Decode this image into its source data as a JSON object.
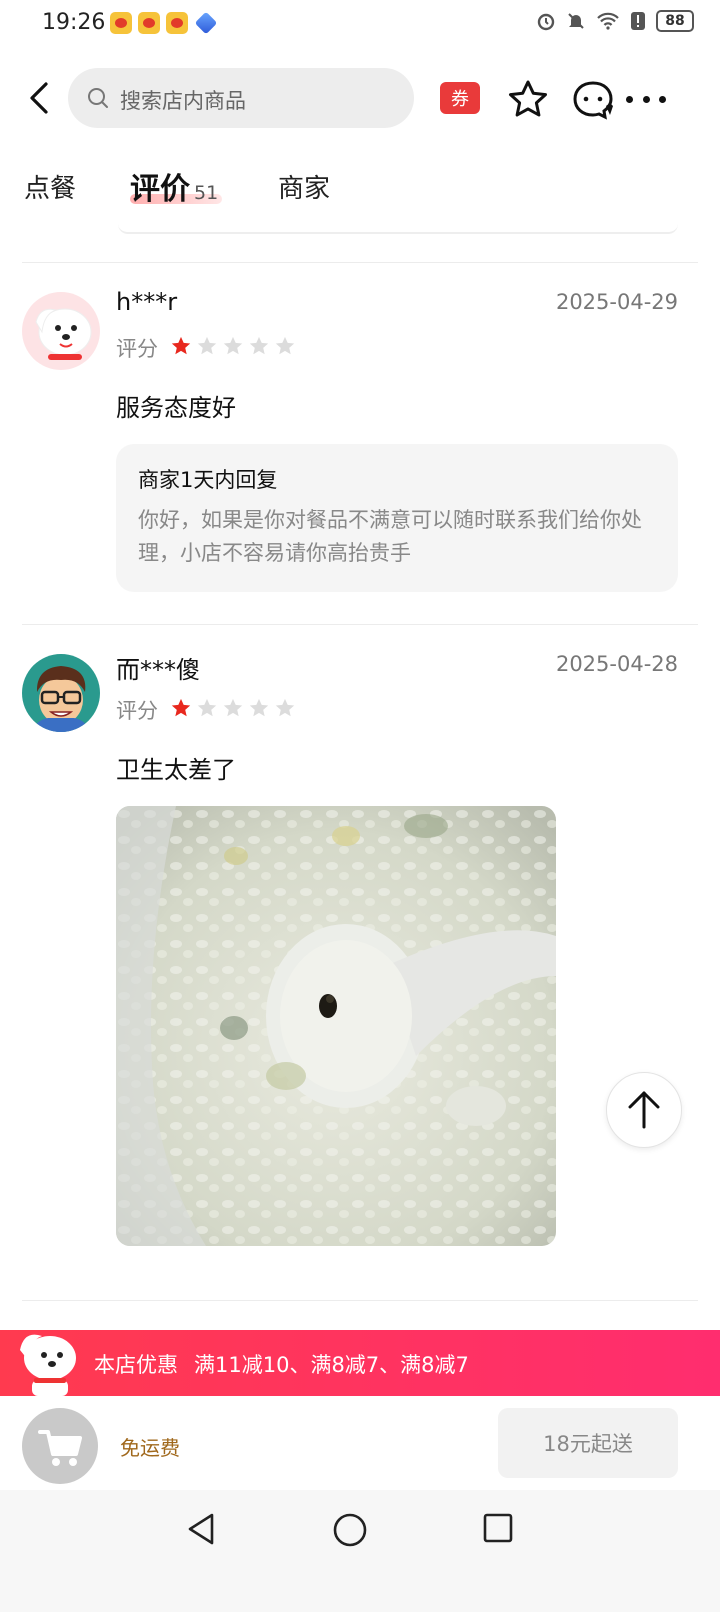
{
  "status_bar": {
    "time": "19:26",
    "battery": "88"
  },
  "header": {
    "search_placeholder": "搜索店内商品",
    "coupon_label": "券"
  },
  "tabs": [
    {
      "label": "点餐"
    },
    {
      "label": "评价",
      "count": "51"
    },
    {
      "label": "商家"
    }
  ],
  "reviews": [
    {
      "user": "h***r",
      "date": "2025-04-29",
      "score_label": "评分",
      "rating": 1,
      "max_rating": 5,
      "comment": "服务态度好",
      "reply": {
        "title": "商家1天内回复",
        "text": "你好，如果是你对餐品不满意可以随时联系我们给你处理，小店不容易请你高抬贵手"
      }
    },
    {
      "user": "而***傻",
      "date": "2025-04-28",
      "score_label": "评分",
      "rating": 1,
      "max_rating": 5,
      "comment": "卫生太差了"
    }
  ],
  "promo": {
    "label": "本店优惠",
    "detail": "满11减10、满8减7、满8减7"
  },
  "cart": {
    "free_shipping": "免运费",
    "min_order": "18元起送"
  },
  "colors": {
    "accent": "#ff3048",
    "star_active": "#e8281e",
    "star_inactive": "#dcdcdc"
  }
}
